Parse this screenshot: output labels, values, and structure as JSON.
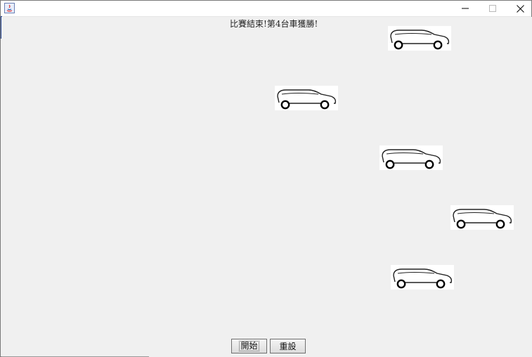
{
  "window": {
    "title": "",
    "controls": [
      "minimize-icon",
      "maximize-icon",
      "close-icon"
    ]
  },
  "status_text": "比賽結束!第4台車獲勝!",
  "cars": [
    {
      "name": "car-1",
      "icon": "car-icon"
    },
    {
      "name": "car-2",
      "icon": "car-icon"
    },
    {
      "name": "car-3",
      "icon": "car-icon"
    },
    {
      "name": "car-4",
      "icon": "car-icon"
    },
    {
      "name": "car-5",
      "icon": "car-icon"
    }
  ],
  "buttons": {
    "start_label": "開始",
    "reset_label": "重設"
  },
  "colors": {
    "background": "#f0f0f0",
    "accent": "#1f3f8f"
  }
}
